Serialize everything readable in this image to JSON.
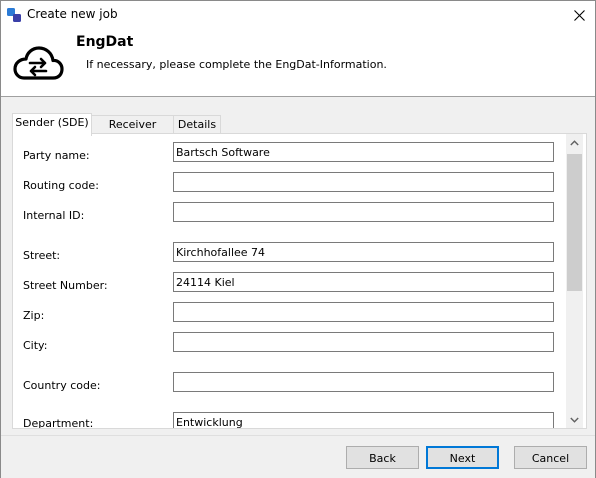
{
  "window": {
    "title": "Create new job"
  },
  "header": {
    "title": "EngDat",
    "subtitle": "If necessary, please complete the EngDat-Information."
  },
  "tabs": [
    {
      "label": "Sender (SDE)",
      "active": true
    },
    {
      "label": "Receiver (RDE)",
      "active": false
    },
    {
      "label": "Details",
      "active": false
    }
  ],
  "form": {
    "party_name": {
      "label": "Party name:",
      "value": "Bartsch Software"
    },
    "routing_code": {
      "label": "Routing code:",
      "value": ""
    },
    "internal_id": {
      "label": "Internal ID:",
      "value": ""
    },
    "street": {
      "label": "Street:",
      "value": "Kirchhofallee 74"
    },
    "street_number": {
      "label": "Street Number:",
      "value": "24114 Kiel"
    },
    "zip": {
      "label": "Zip:",
      "value": ""
    },
    "city": {
      "label": "City:",
      "value": ""
    },
    "country_code": {
      "label": "Country code:",
      "value": ""
    },
    "department": {
      "label": "Department:",
      "value": "Entwicklung"
    }
  },
  "buttons": {
    "back": "Back",
    "next": "Next",
    "cancel": "Cancel"
  },
  "colors": {
    "accent": "#0078d7",
    "dialog_bg": "#f0f0f0",
    "button_bg": "#e1e1e1"
  }
}
